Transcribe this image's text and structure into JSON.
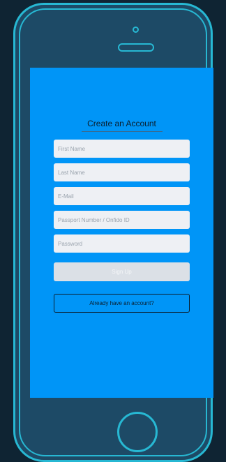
{
  "form": {
    "title": "Create an Account",
    "fields": [
      {
        "placeholder": "First Name",
        "value": ""
      },
      {
        "placeholder": "Last Name",
        "value": ""
      },
      {
        "placeholder": "E-Mail",
        "value": ""
      },
      {
        "placeholder": "Passport Number / Onfido ID",
        "value": ""
      },
      {
        "placeholder": "Password",
        "value": ""
      }
    ],
    "signup_label": "Sign Up",
    "login_label": "Already have an account?"
  },
  "colors": {
    "background": "#0f2433",
    "phone_frame": "#27b8d3",
    "phone_body": "#1d4a66",
    "screen": "#0095f7",
    "field_bg": "#eef0f4",
    "signup_bg": "#dbe0e6"
  }
}
